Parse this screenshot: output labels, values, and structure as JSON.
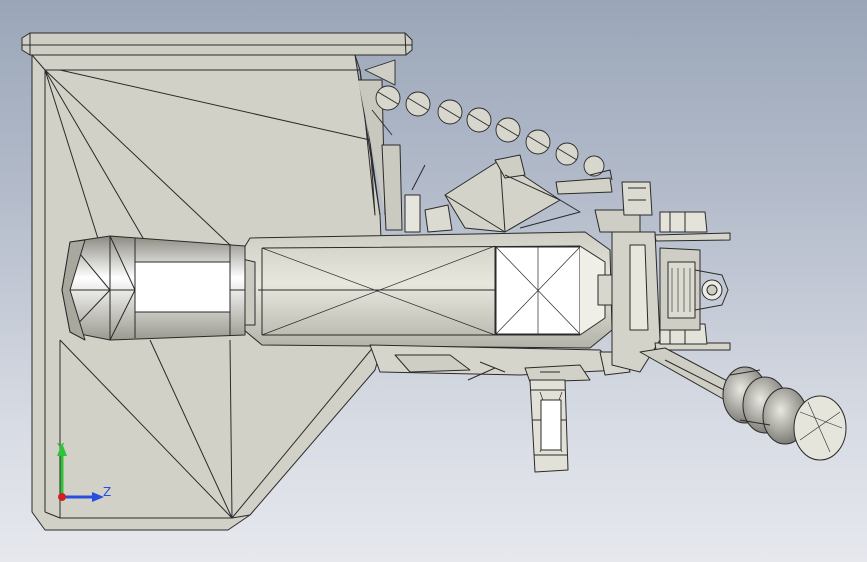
{
  "viewport": {
    "background_top": "#9aa6b8",
    "background_bottom": "#e6e8ee"
  },
  "model": {
    "face_color": "#d6d5cc",
    "shade_color": "#b9b8ae",
    "highlight_color": "#ffffff",
    "edge_color": "#2a2a2a"
  },
  "triad": {
    "y_label": "Y",
    "z_label": "Z",
    "y_color": "#2fc23a",
    "z_color": "#2a4de0",
    "origin_color": "#d22020"
  }
}
